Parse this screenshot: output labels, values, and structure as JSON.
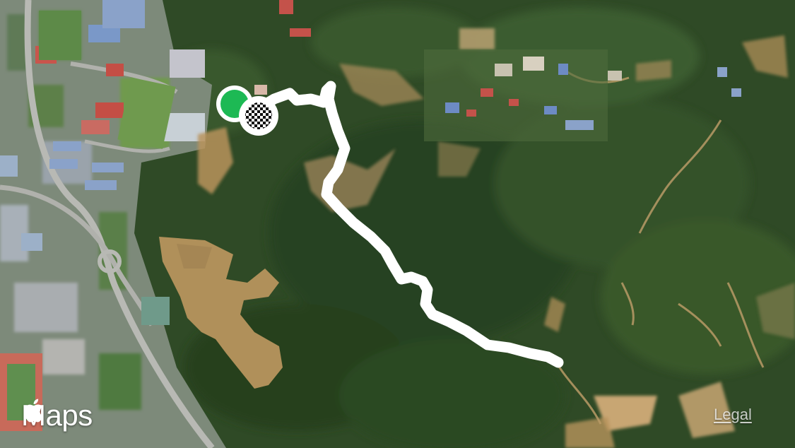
{
  "map": {
    "view": "satellite",
    "colors": {
      "route": "#ffffff",
      "start_marker": "#1db954",
      "finish_marker": "checkered-black-white",
      "forest": "#2f4a26",
      "soil": "#b8935c",
      "water": "#b0905a"
    },
    "markers": [
      {
        "name": "start",
        "icon": "green-circle-icon"
      },
      {
        "name": "finish",
        "icon": "checkered-flag-icon"
      }
    ]
  },
  "attribution": {
    "brand": "Maps",
    "brand_icon": "apple-logo-icon",
    "legal_label": "Legal"
  }
}
